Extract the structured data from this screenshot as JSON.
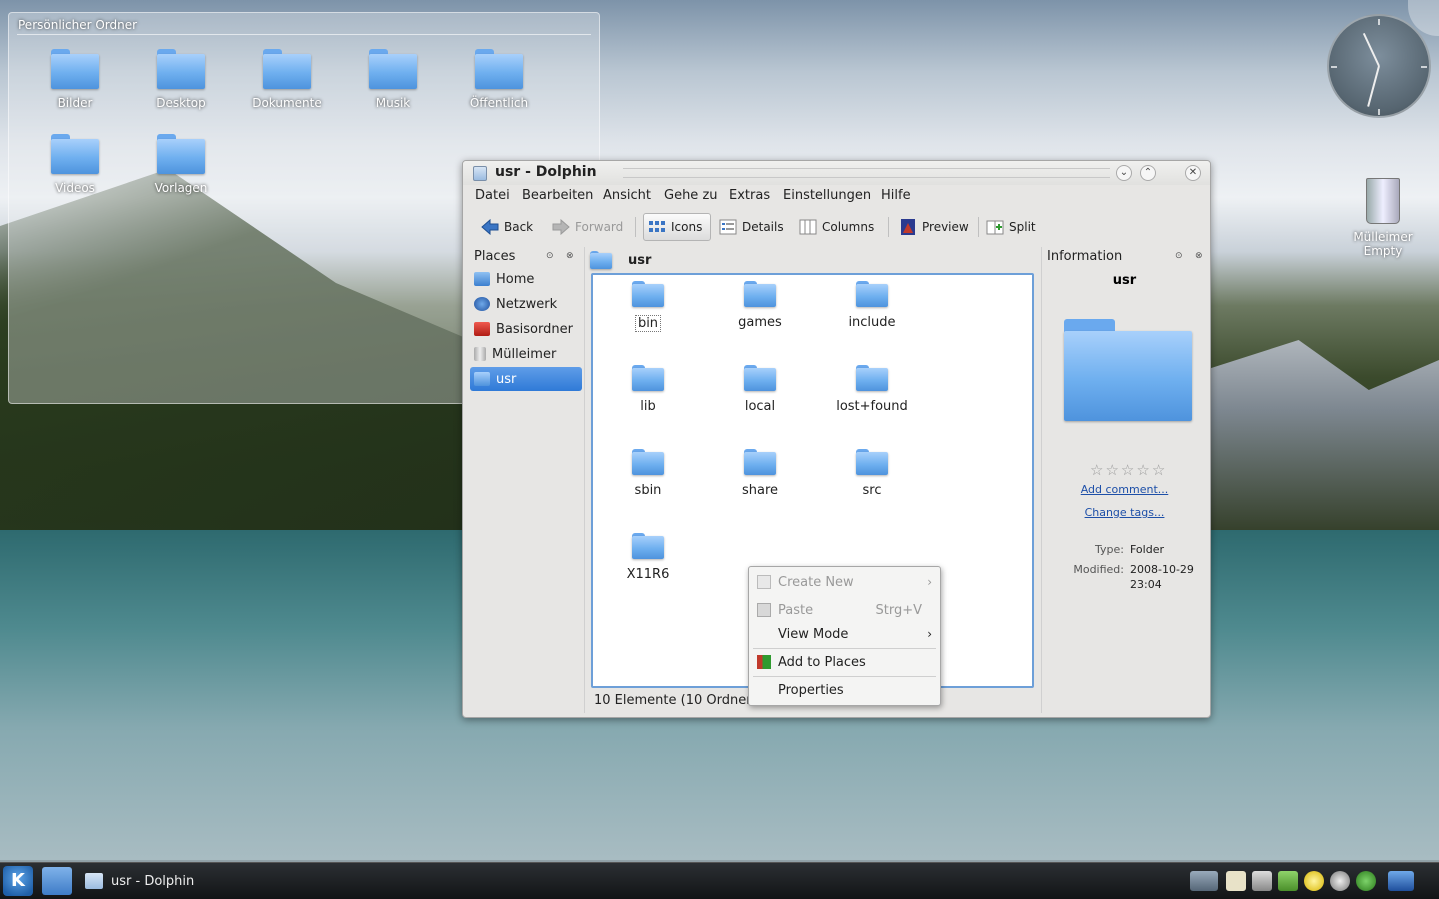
{
  "desktop": {
    "folderview": {
      "title": "Persönlicher Ordner",
      "items": [
        {
          "label": "Bilder"
        },
        {
          "label": "Desktop"
        },
        {
          "label": "Dokumente"
        },
        {
          "label": "Musik"
        },
        {
          "label": "Öffentlich"
        },
        {
          "label": "Videos"
        },
        {
          "label": "Vorlagen"
        }
      ]
    },
    "trash": {
      "label": "Mülleimer",
      "status": "Empty"
    }
  },
  "window": {
    "title": "usr - Dolphin",
    "menu": [
      "Datei",
      "Bearbeiten",
      "Ansicht",
      "Gehe zu",
      "Extras",
      "Einstellungen",
      "Hilfe"
    ],
    "toolbar": {
      "back": "Back",
      "forward": "Forward",
      "icons": "Icons",
      "details": "Details",
      "columns": "Columns",
      "preview": "Preview",
      "split": "Split"
    },
    "places": {
      "title": "Places",
      "items": [
        {
          "label": "Home"
        },
        {
          "label": "Netzwerk"
        },
        {
          "label": "Basisordner"
        },
        {
          "label": "Mülleimer"
        },
        {
          "label": "usr"
        }
      ]
    },
    "breadcrumb": "usr",
    "files": [
      {
        "label": "bin"
      },
      {
        "label": "games"
      },
      {
        "label": "include"
      },
      {
        "label": "lib"
      },
      {
        "label": "local"
      },
      {
        "label": "lost+found"
      },
      {
        "label": "sbin"
      },
      {
        "label": "share"
      },
      {
        "label": "src"
      },
      {
        "label": "X11R6"
      }
    ],
    "status": "10 Elemente (10 Ordner,",
    "info": {
      "title": "Information",
      "name": "usr",
      "add_comment": "Add comment...",
      "change_tags": "Change tags...",
      "type_key": "Type:",
      "type_val": "Folder",
      "modified_key": "Modified:",
      "modified_date": "2008-10-29",
      "modified_time": "23:04",
      "rating": 0
    },
    "context_menu": {
      "create_new": "Create New",
      "paste": "Paste",
      "paste_shortcut": "Strg+V",
      "view_mode": "View Mode",
      "add_to_places": "Add to Places",
      "properties": "Properties"
    }
  },
  "taskbar": {
    "task": "usr - Dolphin"
  },
  "colors": {
    "selection": "#2f7ad7",
    "view_border": "#6d9fd8",
    "link": "#1d4fa8",
    "folder": "#6eafef"
  }
}
